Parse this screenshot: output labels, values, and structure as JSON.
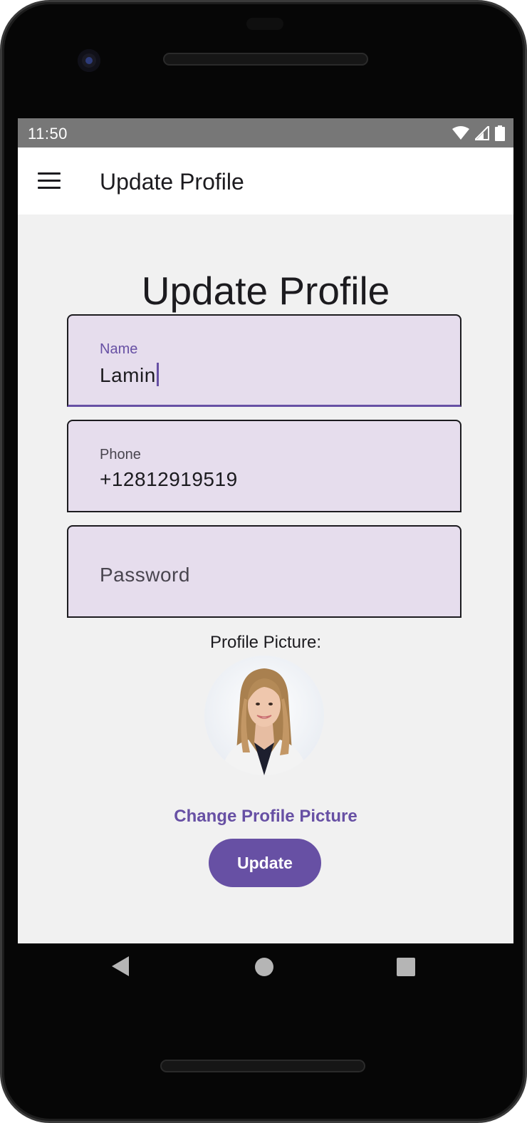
{
  "status_bar": {
    "time": "11:50",
    "icons": [
      "wifi-icon",
      "cellular-signal-icon",
      "battery-icon"
    ]
  },
  "app_bar": {
    "menu_icon": "hamburger-menu-icon",
    "title": "Update Profile"
  },
  "form": {
    "heading": "Update Profile",
    "name": {
      "label": "Name",
      "value": "Lamin"
    },
    "phone": {
      "label": "Phone",
      "value": "+12812919519"
    },
    "password": {
      "placeholder": "Password",
      "value": ""
    },
    "profile_picture_label": "Profile Picture:",
    "change_picture_label": "Change Profile Picture",
    "update_label": "Update"
  },
  "nav_bar": {
    "icons": [
      "back-icon",
      "home-icon",
      "recents-icon"
    ]
  },
  "colors": {
    "primary": "#6750a4",
    "field_background": "#e6dded",
    "screen_background": "#f1f1f1",
    "status_bar": "#777777"
  }
}
